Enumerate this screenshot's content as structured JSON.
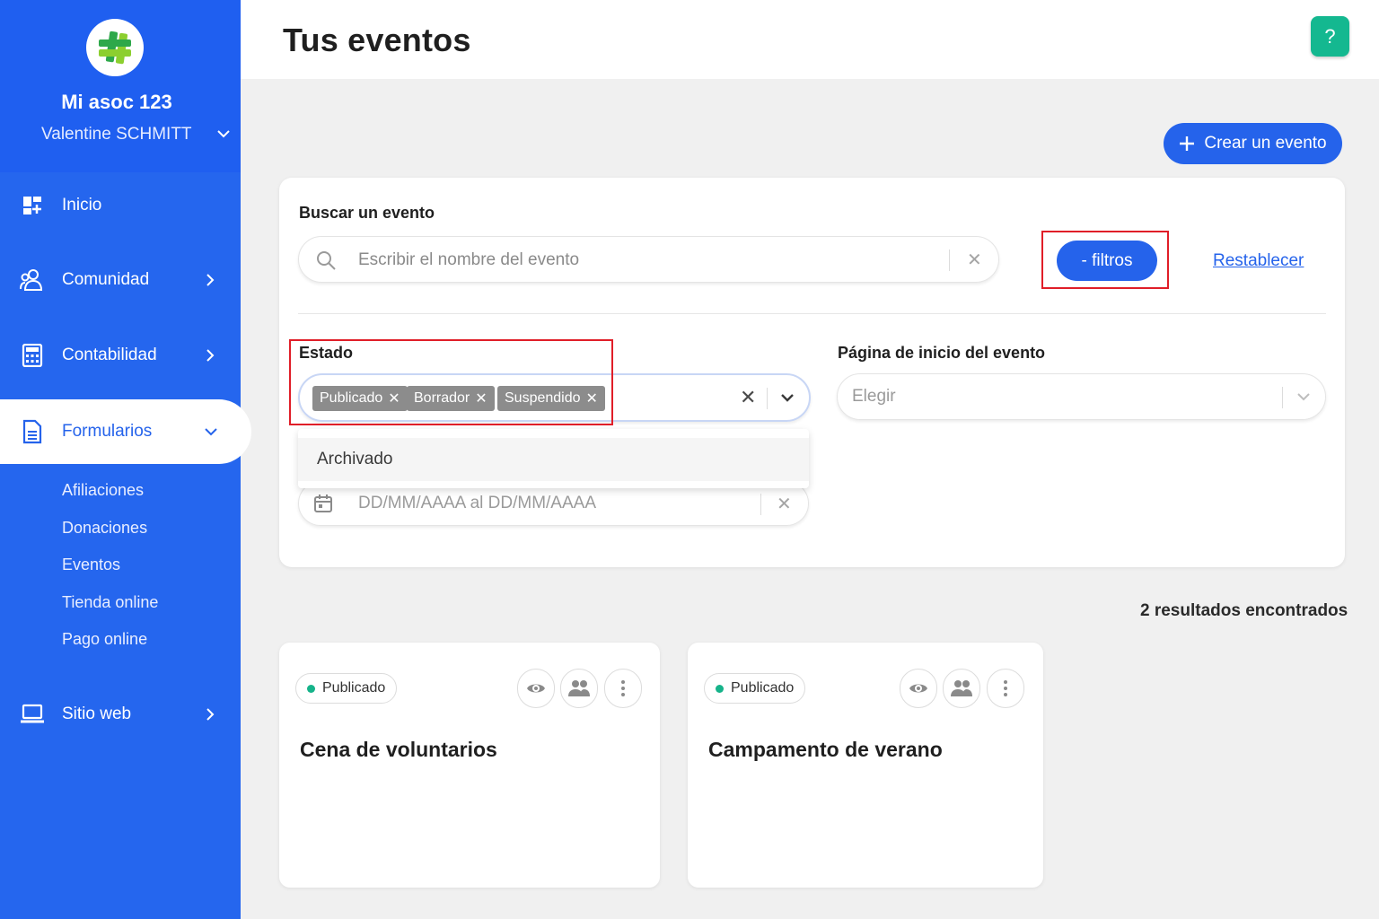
{
  "sidebar": {
    "org_name": "Mi asoc 123",
    "user_name": "Valentine SCHMITT",
    "nav": [
      {
        "label": "Inicio",
        "icon": "dashboard-icon"
      },
      {
        "label": "Comunidad",
        "icon": "users-icon"
      },
      {
        "label": "Contabilidad",
        "icon": "calculator-icon"
      },
      {
        "label": "Formularios",
        "icon": "document-icon"
      },
      {
        "label": "Sitio web",
        "icon": "laptop-icon"
      }
    ],
    "sub_items": [
      "Afiliaciones",
      "Donaciones",
      "Eventos",
      "Tienda online",
      "Pago online"
    ]
  },
  "header": {
    "title": "Tus eventos",
    "help_label": "?"
  },
  "create_button": "Crear un evento",
  "filters": {
    "search_label": "Buscar un evento",
    "search_placeholder": "Escribir el nombre del evento",
    "filters_button": "- filtros",
    "reset_link": "Restablecer",
    "estado_label": "Estado",
    "estado_chips": [
      "Publicado",
      "Borrador",
      "Suspendido"
    ],
    "estado_dropdown_option": "Archivado",
    "pagina_label": "Página de inicio del evento",
    "pagina_placeholder": "Elegir",
    "date_placeholder": "DD/MM/AAAA al DD/MM/AAAA"
  },
  "results_text": "2 resultados encontrados",
  "cards": [
    {
      "status": "Publicado",
      "title": "Cena de voluntarios"
    },
    {
      "status": "Publicado",
      "title": "Campamento de verano"
    }
  ],
  "colors": {
    "primary": "#2563eb",
    "sidebar": "#2566ee",
    "help": "#14b890",
    "status_published": "#16b38a",
    "highlight": "#e01e28"
  }
}
